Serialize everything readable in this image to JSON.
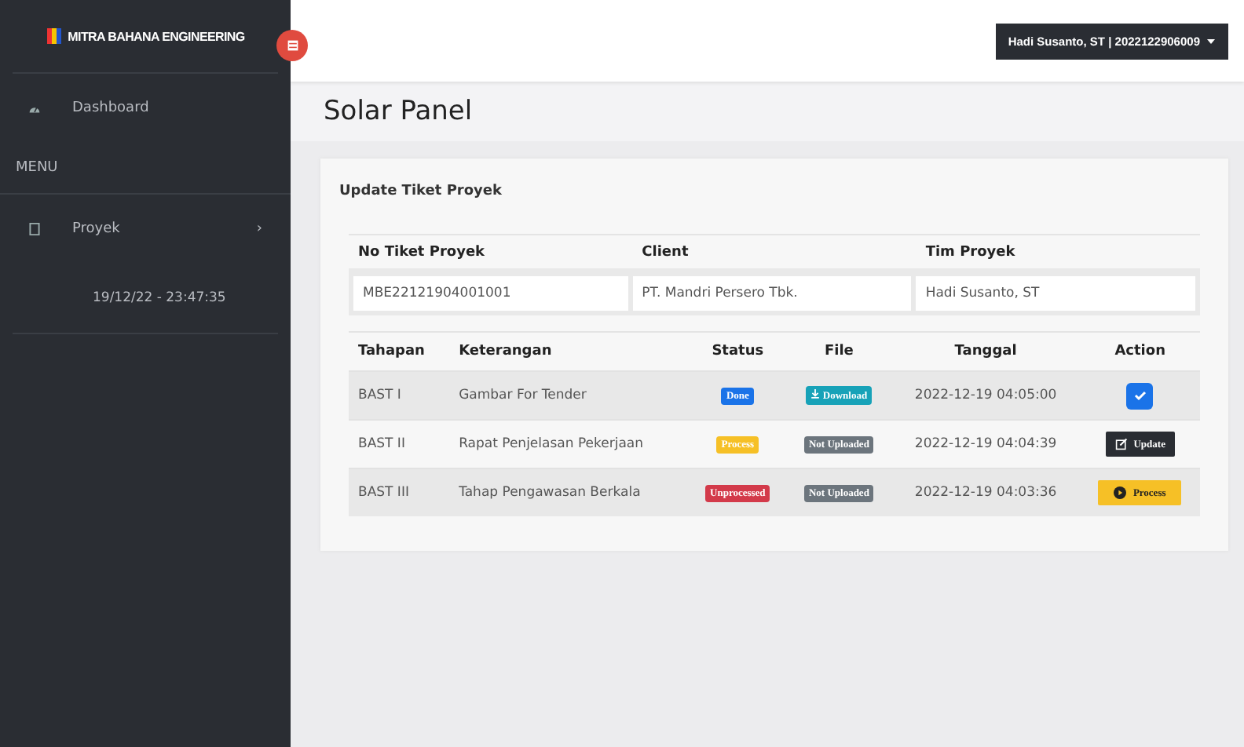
{
  "sidebar": {
    "brand": "MITRA BAHANA ENGINEERING",
    "items": [
      {
        "label": "Dashboard",
        "kind": "link"
      },
      {
        "label": "MENU",
        "kind": "header"
      },
      {
        "label": "Proyek",
        "kind": "link",
        "arrow": "›"
      },
      {
        "label": "19/12/22 - 23:47:35",
        "kind": "clock"
      }
    ]
  },
  "topbar": {
    "user": "Hadi Susanto, ST | 2022122906009"
  },
  "page_title": "Solar Panel",
  "card": {
    "title": "Update Tiket Proyek",
    "fields": [
      {
        "label": "No Tiket Proyek",
        "value": "MBE22121904001001"
      },
      {
        "label": "Client",
        "value": "PT. Mandri Persero Tbk."
      },
      {
        "label": "Tim Proyek",
        "value": "Hadi Susanto, ST"
      }
    ],
    "table": {
      "columns": [
        "Tahapan",
        "Keterangan",
        "Status",
        "File",
        "Tanggal",
        "Action"
      ],
      "rows": [
        {
          "tahapan": "BAST I",
          "keterangan": "Gambar For Tender",
          "status": {
            "label": "Done",
            "kind": "done"
          },
          "file": {
            "label": "Download",
            "kind": "download"
          },
          "tanggal": "2022-12-19 04:05:00",
          "action": {
            "kind": "check"
          }
        },
        {
          "tahapan": "BAST II",
          "keterangan": "Rapat Penjelasan Pekerjaan",
          "status": {
            "label": "Process",
            "kind": "process"
          },
          "file": {
            "label": "Not Uploaded",
            "kind": "missing"
          },
          "tanggal": "2022-12-19 04:04:39",
          "action": {
            "kind": "update",
            "label": "Update"
          }
        },
        {
          "tahapan": "BAST III",
          "keterangan": "Tahap Pengawasan Berkala",
          "status": {
            "label": "Unprocessed",
            "kind": "unprocessed"
          },
          "file": {
            "label": "Not Uploaded",
            "kind": "missing"
          },
          "tanggal": "2022-12-19 04:03:36",
          "action": {
            "kind": "process",
            "label": "Process"
          }
        }
      ]
    }
  }
}
